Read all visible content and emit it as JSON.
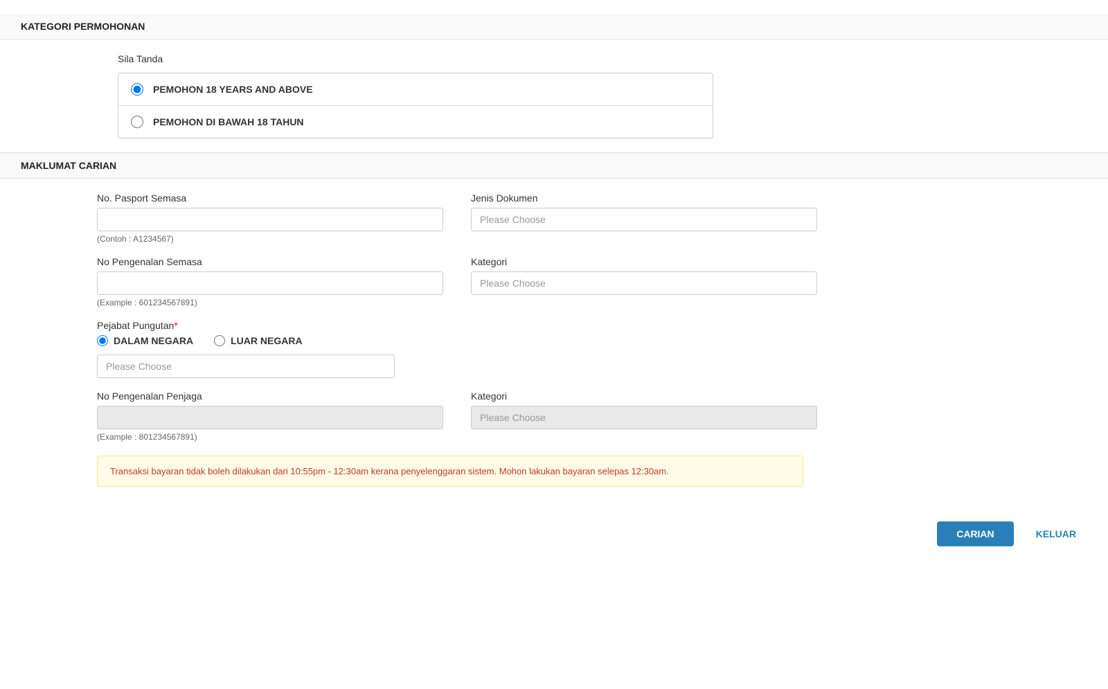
{
  "kategori": {
    "section_title": "KATEGORI PERMOHONAN",
    "sila_tanda_label": "Sila Tanda",
    "options": [
      {
        "id": "opt1",
        "label": "PEMOHON 18 YEARS AND ABOVE",
        "checked": true
      },
      {
        "id": "opt2",
        "label": "PEMOHON DI BAWAH 18 TAHUN",
        "checked": false
      }
    ]
  },
  "maklumat": {
    "section_title": "MAKLUMAT CARIAN",
    "fields": {
      "no_pasport": {
        "label": "No. Pasport Semasa",
        "placeholder": "",
        "hint": "(Contoh : A1234567)"
      },
      "jenis_dokumen": {
        "label": "Jenis Dokumen",
        "placeholder": "Please Choose"
      },
      "no_pengenalan": {
        "label": "No Pengenalan Semasa",
        "placeholder": "",
        "hint": "(Example : 601234567891)"
      },
      "kategori": {
        "label": "Kategori",
        "placeholder": "Please Choose"
      },
      "pejabat_pungutan": {
        "label": "Pejabat Pungutan",
        "required": true,
        "radio_options": [
          {
            "id": "dalam",
            "label": "DALAM NEGARA",
            "checked": true
          },
          {
            "id": "luar",
            "label": "LUAR NEGARA",
            "checked": false
          }
        ],
        "placeholder": "Please Choose"
      },
      "no_pengenalan_penjaga": {
        "label": "No Pengenalan Penjaga",
        "placeholder": "",
        "hint": "(Example : 801234567891)",
        "disabled": true
      },
      "kategori_penjaga": {
        "label": "Kategori",
        "placeholder": "Please Choose",
        "disabled": true
      }
    }
  },
  "alert": {
    "message": "Transaksi bayaran tidak boleh dilakukan dari 10:55pm - 12:30am kerana penyelenggaran sistem. Mohon lakukan bayaran selepas 12:30am."
  },
  "buttons": {
    "carian": "CARIAN",
    "keluar": "KELUAR"
  }
}
